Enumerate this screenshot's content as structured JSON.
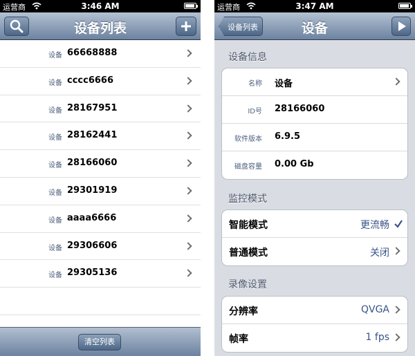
{
  "left": {
    "status": {
      "carrier": "运营商",
      "time": "3:46 AM"
    },
    "title": "设备列表",
    "devices": [
      {
        "label": "设备",
        "id": "66668888"
      },
      {
        "label": "设备",
        "id": "cccc6666"
      },
      {
        "label": "设备",
        "id": "28167951"
      },
      {
        "label": "设备",
        "id": "28162441"
      },
      {
        "label": "设备",
        "id": "28166060"
      },
      {
        "label": "设备",
        "id": "29301919"
      },
      {
        "label": "设备",
        "id": "aaaa6666"
      },
      {
        "label": "设备",
        "id": "29306606"
      },
      {
        "label": "设备",
        "id": "29305136"
      }
    ],
    "clear_label": "清空列表"
  },
  "right": {
    "status": {
      "carrier": "运营商",
      "time": "3:47 AM"
    },
    "back_label": "设备列表",
    "title": "设备",
    "info": {
      "header": "设备信息",
      "rows": [
        {
          "key": "名称",
          "value": "设备"
        },
        {
          "key": "ID号",
          "value": "28166060"
        },
        {
          "key": "软件版本",
          "value": "6.9.5"
        },
        {
          "key": "磁盘容量",
          "value": "0.00 Gb"
        }
      ]
    },
    "monitor": {
      "header": "监控模式",
      "rows": [
        {
          "key": "智能模式",
          "value": "更流畅"
        },
        {
          "key": "普通模式",
          "value": "关闭"
        }
      ]
    },
    "record": {
      "header": "录像设置",
      "rows": [
        {
          "key": "分辨率",
          "value": "QVGA"
        },
        {
          "key": "帧率",
          "value": "1 fps"
        }
      ]
    }
  }
}
